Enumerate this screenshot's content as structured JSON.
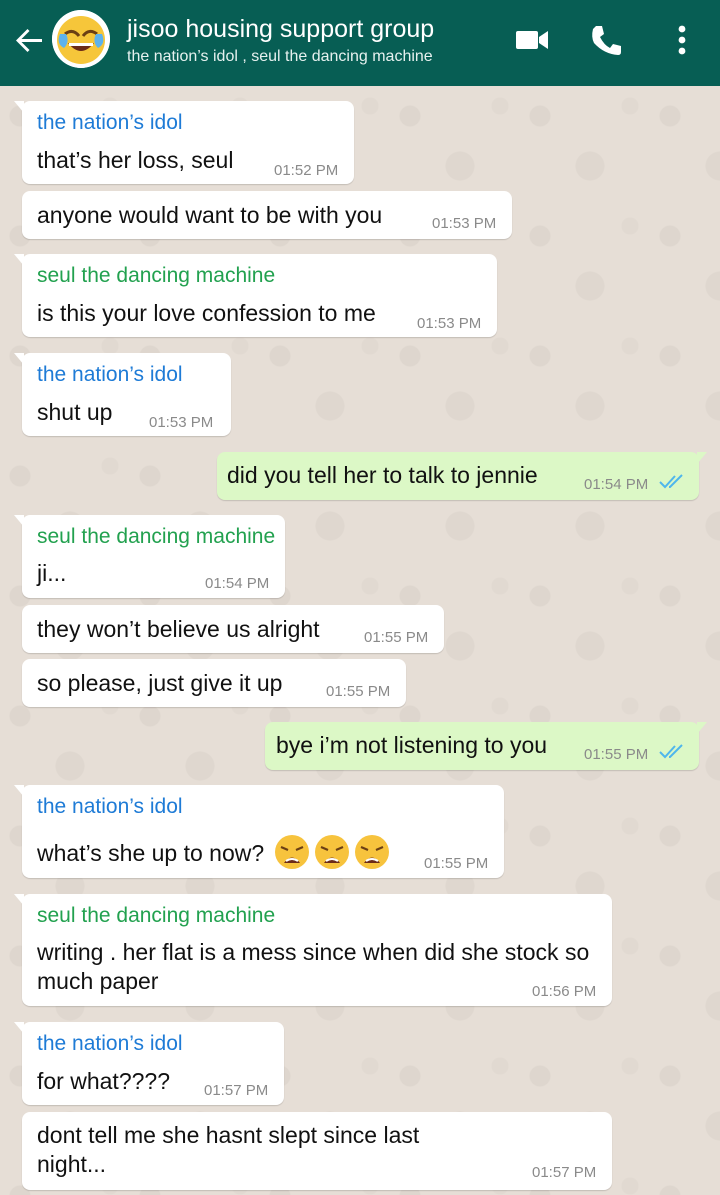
{
  "header": {
    "title": "jisoo housing support group",
    "subtitle": "the nation’s idol , seul the dancing machine",
    "icons": [
      "back-arrow-icon",
      "group-avatar-emoji",
      "video-call-icon",
      "voice-call-icon",
      "more-options-icon"
    ]
  },
  "colors": {
    "header_bg": "#075e54",
    "incoming_bubble": "#ffffff",
    "outgoing_bubble": "#dcf8c6",
    "sender_blue": "#1e7bd6",
    "sender_green": "#22a14f",
    "read_ticks": "#4fb6ec"
  },
  "messages": [
    {
      "sender": "the nation’s idol",
      "text": "that’s her loss, seul",
      "time": "01:52 PM"
    },
    {
      "text": "anyone would want to be with you",
      "time": "01:53 PM"
    },
    {
      "sender": "seul the dancing machine",
      "text": "is this your love confession to me",
      "time": "01:53 PM"
    },
    {
      "sender": "the nation’s idol",
      "text": "shut up",
      "time": "01:53 PM"
    },
    {
      "outgoing": true,
      "text": "did you tell her to talk to jennie",
      "time": "01:54 PM"
    },
    {
      "sender": "seul the dancing machine",
      "text": "ji...",
      "time": "01:54 PM"
    },
    {
      "text": "they won’t believe us alright",
      "time": "01:55 PM"
    },
    {
      "text": "so please, just give it up",
      "time": "01:55 PM"
    },
    {
      "outgoing": true,
      "text": "bye i’m not listening to you",
      "time": "01:55 PM"
    },
    {
      "sender": "the nation’s idol",
      "text": "what’s she up to now?",
      "emoji": "weary-face-emoji x3",
      "time": "01:55 PM"
    },
    {
      "sender": "seul the dancing machine",
      "text": "writing . her flat is a mess since when did she stock so much paper",
      "time": "01:56 PM"
    },
    {
      "sender": "the nation’s idol",
      "text": "for what????",
      "time": "01:57 PM"
    },
    {
      "text": "dont tell me she hasnt slept since last night...",
      "time": "01:57 PM"
    }
  ]
}
